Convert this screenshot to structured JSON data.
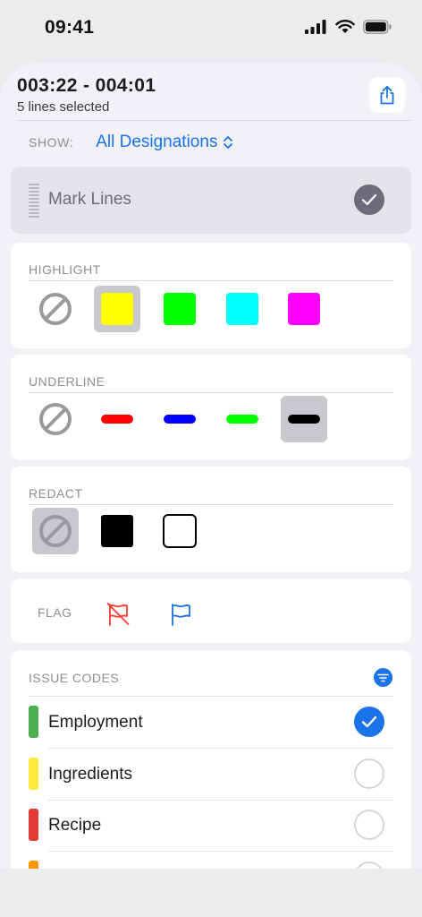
{
  "status_bar": {
    "time": "09:41"
  },
  "header": {
    "range": "003:22 - 004:01",
    "selection": "5 lines selected"
  },
  "show": {
    "label": "SHOW:",
    "value": "All Designations"
  },
  "mark_lines": {
    "label": "Mark Lines",
    "checked": true
  },
  "highlight": {
    "title": "HIGHLIGHT",
    "selected_index": 1,
    "options": [
      {
        "name": "none",
        "color": ""
      },
      {
        "name": "yellow",
        "color": "#ffff00"
      },
      {
        "name": "green",
        "color": "#00ff00"
      },
      {
        "name": "cyan",
        "color": "#00ffff"
      },
      {
        "name": "magenta",
        "color": "#ff00ff"
      }
    ]
  },
  "underline": {
    "title": "UNDERLINE",
    "selected_index": 4,
    "options": [
      {
        "name": "none",
        "color": ""
      },
      {
        "name": "red",
        "color": "#ff0000"
      },
      {
        "name": "blue",
        "color": "#0000ff"
      },
      {
        "name": "green",
        "color": "#00ff00"
      },
      {
        "name": "black",
        "color": "#000000"
      }
    ]
  },
  "redact": {
    "title": "REDACT",
    "selected_index": 0,
    "options": [
      {
        "name": "none"
      },
      {
        "name": "filled-black",
        "color": "#000000"
      },
      {
        "name": "outline-black",
        "color": "#000000"
      }
    ]
  },
  "flag": {
    "label": "FLAG",
    "options": [
      {
        "name": "remove-flag",
        "color": "#ff3b30"
      },
      {
        "name": "flag",
        "color": "#1a73e8"
      }
    ]
  },
  "issue_codes": {
    "title": "ISSUE CODES",
    "items": [
      {
        "label": "Employment",
        "color": "#4caf50",
        "checked": true
      },
      {
        "label": "Ingredients",
        "color": "#ffeb3b",
        "checked": false
      },
      {
        "label": "Recipe",
        "color": "#e53935",
        "checked": false
      },
      {
        "label": "",
        "color": "#ff9800",
        "checked": false
      }
    ]
  },
  "colors": {
    "accent": "#1a73e8",
    "sheet_bg": "#f2f2f6"
  }
}
